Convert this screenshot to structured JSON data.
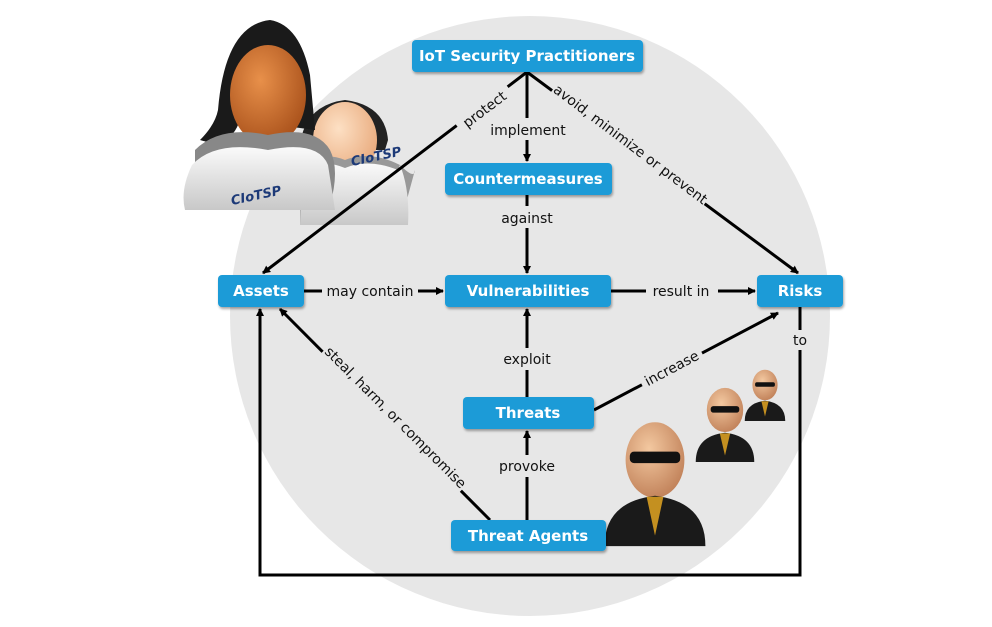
{
  "colors": {
    "box": "#1b9bd7",
    "background_circle": "#e7e7e7",
    "arrow": "#000000"
  },
  "nodes": {
    "practitioners": "IoT Security Practitioners",
    "countermeasures": "Countermeasures",
    "assets": "Assets",
    "vulnerabilities": "Vulnerabilities",
    "risks": "Risks",
    "threats": "Threats",
    "threat_agents": "Threat Agents"
  },
  "edges": {
    "protect": "protect",
    "implement": "implement",
    "avoid": "avoid, minimize or prevent",
    "against": "against",
    "may_contain": "may contain",
    "result_in": "result in",
    "to": "to",
    "exploit": "exploit",
    "increase": "increase",
    "steal": "steal, harm, or compromise",
    "provoke": "provoke"
  },
  "practitioner_shirt_text": "CIoTSP",
  "icons": [
    "practitioner-people-icon",
    "threat-agent-people-icon"
  ]
}
